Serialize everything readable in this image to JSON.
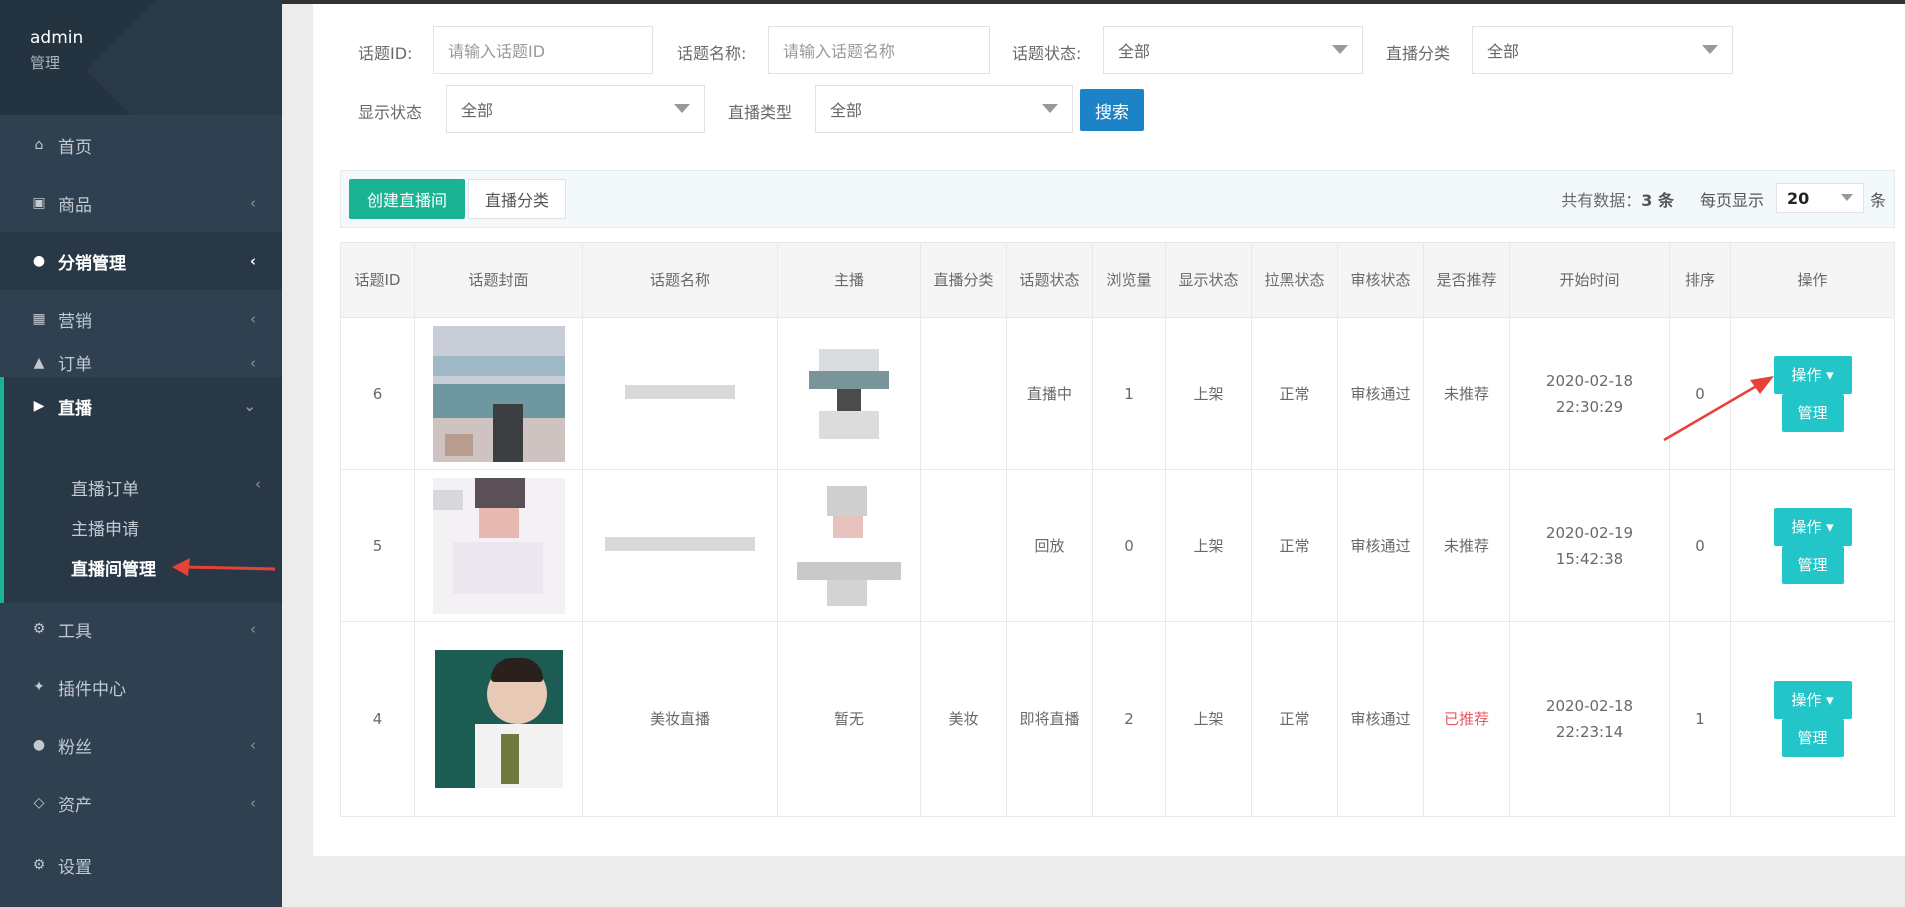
{
  "sidebar": {
    "user_name": "admin",
    "user_role": "管理",
    "items": [
      {
        "label": "首页",
        "icon": "home-icon"
      },
      {
        "label": "商品",
        "icon": "product-icon"
      },
      {
        "label": "分销管理",
        "icon": "users-icon"
      },
      {
        "label": "营销",
        "icon": "gift-icon"
      },
      {
        "label": "订单",
        "icon": "cart-icon"
      },
      {
        "label": "直播",
        "icon": "video-icon"
      },
      {
        "label": "工具",
        "icon": "gear-icon"
      },
      {
        "label": "插件中心",
        "icon": "puzzle-icon"
      },
      {
        "label": "粉丝",
        "icon": "user-icon"
      },
      {
        "label": "资产",
        "icon": "diamond-icon"
      },
      {
        "label": "设置",
        "icon": "gear-icon"
      }
    ],
    "live_sub": [
      "直播订单",
      "主播申请",
      "直播间管理"
    ]
  },
  "filters": {
    "topic_id_label": "话题ID:",
    "topic_id_placeholder": "请输入话题ID",
    "topic_name_label": "话题名称:",
    "topic_name_placeholder": "请输入话题名称",
    "topic_status_label": "话题状态:",
    "topic_status_value": "全部",
    "category_label": "直播分类",
    "category_value": "全部",
    "display_label": "显示状态",
    "display_value": "全部",
    "type_label": "直播类型",
    "type_value": "全部",
    "search_button": "搜索"
  },
  "toolbar": {
    "create_button": "创建直播间",
    "category_button": "直播分类",
    "total_prefix": "共有数据：",
    "total_count": "3 条",
    "per_page_label": "每页显示",
    "per_page_value": "20",
    "per_page_unit": "条"
  },
  "table": {
    "headers": [
      "话题ID",
      "话题封面",
      "话题名称",
      "主播",
      "直播分类",
      "话题状态",
      "浏览量",
      "显示状态",
      "拉黑状态",
      "审核状态",
      "是否推荐",
      "开始时间",
      "排序",
      "操作"
    ],
    "rows": [
      {
        "id": "6",
        "name": "",
        "anchor": "",
        "category": "",
        "status": "直播中",
        "views": "1",
        "display": "上架",
        "black": "正常",
        "audit": "审核通过",
        "recommend": "未推荐",
        "start_date": "2020-02-18",
        "start_time": "22:30:29",
        "sort": "0"
      },
      {
        "id": "5",
        "name": "",
        "anchor": "",
        "category": "",
        "status": "回放",
        "views": "0",
        "display": "上架",
        "black": "正常",
        "audit": "审核通过",
        "recommend": "未推荐",
        "start_date": "2020-02-19",
        "start_time": "15:42:38",
        "sort": "0"
      },
      {
        "id": "4",
        "name": "美妆直播",
        "anchor": "暂无",
        "category": "美妆",
        "status": "即将直播",
        "views": "2",
        "display": "上架",
        "black": "正常",
        "audit": "审核通过",
        "recommend": "已推荐",
        "start_date": "2020-02-18",
        "start_time": "22:23:14",
        "sort": "1"
      }
    ],
    "op_button": "操作",
    "manage_button": "管理"
  },
  "colors": {
    "sidebar_bg": "#2f4050",
    "accent_green": "#1ab394",
    "search_blue": "#1c84c6",
    "op_cyan": "#23c6c8",
    "recommended_red": "#ed5565",
    "annotation_arrow": "#e8413a"
  }
}
